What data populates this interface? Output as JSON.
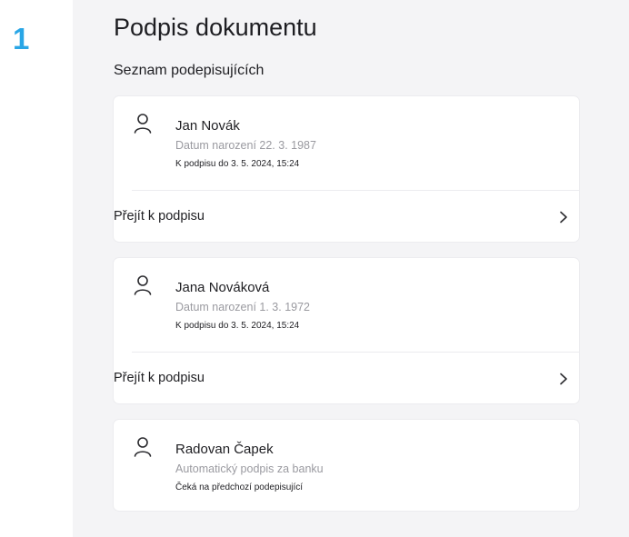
{
  "step": {
    "number": "1"
  },
  "page": {
    "title": "Podpis dokumentu",
    "section_title": "Seznam podepisujících"
  },
  "signers": [
    {
      "name": "Jan Novák",
      "detail": "Datum narození 22. 3. 1987",
      "status": "K podpisu do 3. 5. 2024, 15:24",
      "action_label": "Přejít k podpisu",
      "icon": "person-icon"
    },
    {
      "name": "Jana Nováková",
      "detail": "Datum narození 1. 3. 1972",
      "status": "K podpisu do 3. 5. 2024, 15:24",
      "action_label": "Přejít k podpisu",
      "icon": "person-icon"
    },
    {
      "name": "Radovan Čapek",
      "detail": "Automatický podpis za banku",
      "status": "Čeká na předchozí podepisující",
      "icon": "person-icon"
    }
  ],
  "colors": {
    "accent": "#29a6e6",
    "background": "#f4f4f6",
    "card": "#ffffff",
    "text": "#1e1e22",
    "muted_text": "#9a9aa0"
  }
}
